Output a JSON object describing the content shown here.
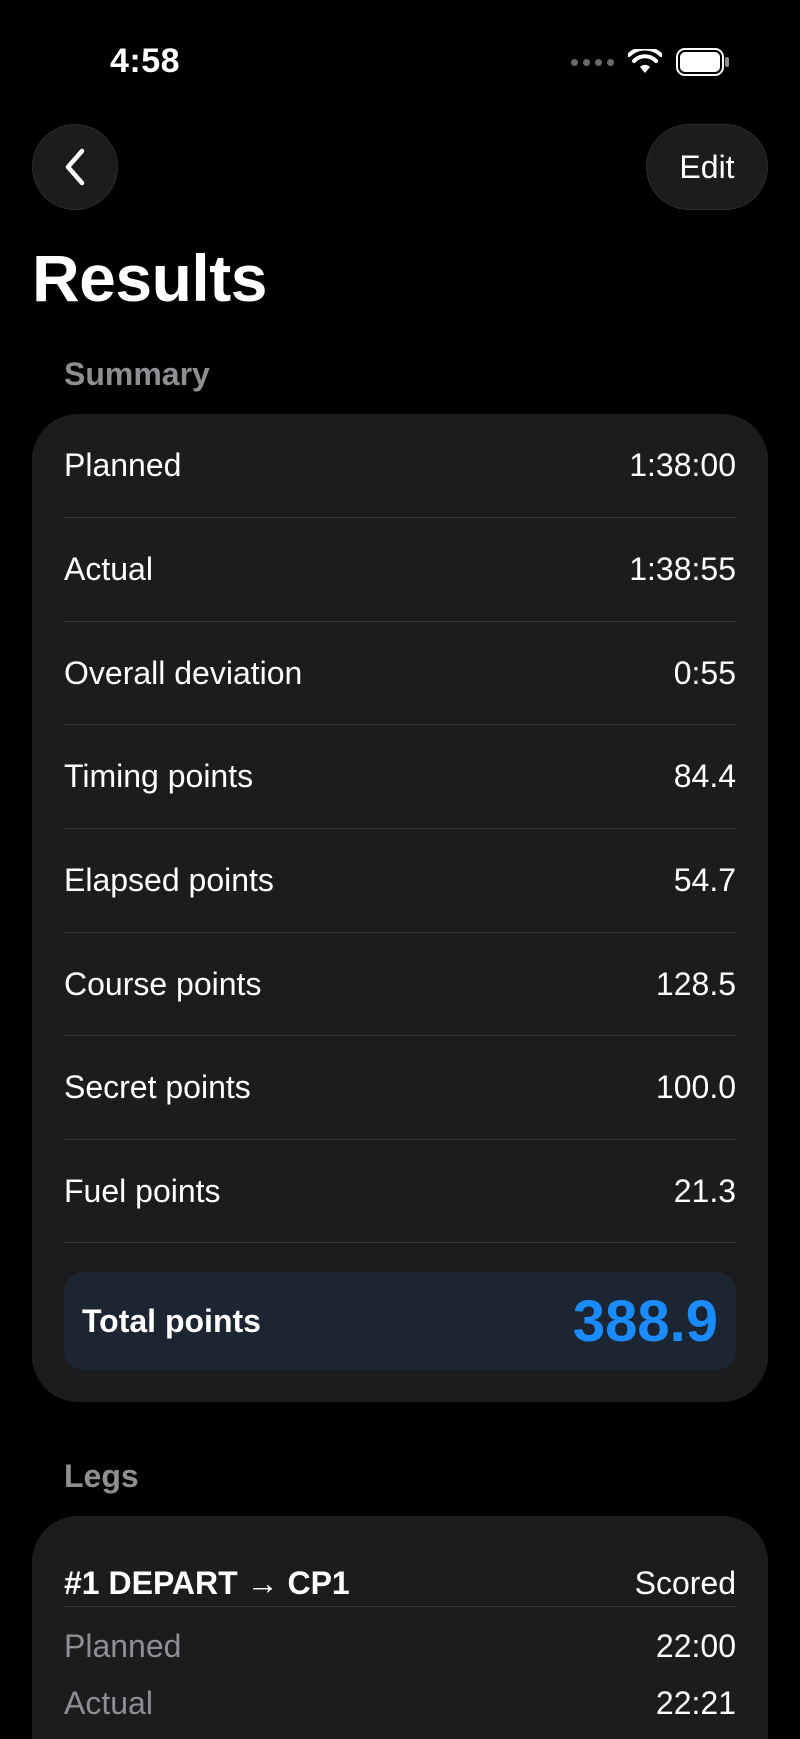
{
  "status_bar": {
    "time": "4:58"
  },
  "nav": {
    "edit_label": "Edit"
  },
  "page": {
    "title": "Results"
  },
  "summary": {
    "header": "Summary",
    "rows": [
      {
        "label": "Planned",
        "value": "1:38:00"
      },
      {
        "label": "Actual",
        "value": "1:38:55"
      },
      {
        "label": "Overall deviation",
        "value": "0:55"
      },
      {
        "label": "Timing points",
        "value": "84.4"
      },
      {
        "label": "Elapsed points",
        "value": "54.7"
      },
      {
        "label": "Course points",
        "value": "128.5"
      },
      {
        "label": "Secret points",
        "value": "100.0"
      },
      {
        "label": "Fuel points",
        "value": "21.3"
      }
    ],
    "total_label": "Total points",
    "total_value": "388.9"
  },
  "legs": {
    "header": "Legs",
    "items": [
      {
        "title": "#1  DEPART → CP1",
        "status": "Scored",
        "planned_label": "Planned",
        "planned_value": "22:00",
        "actual_label": "Actual",
        "actual_value": "22:21"
      }
    ]
  },
  "colors": {
    "background": "#000000",
    "card": "#1c1c1e",
    "accent": "#1a8cff",
    "secondary_text": "#8e8e93"
  }
}
